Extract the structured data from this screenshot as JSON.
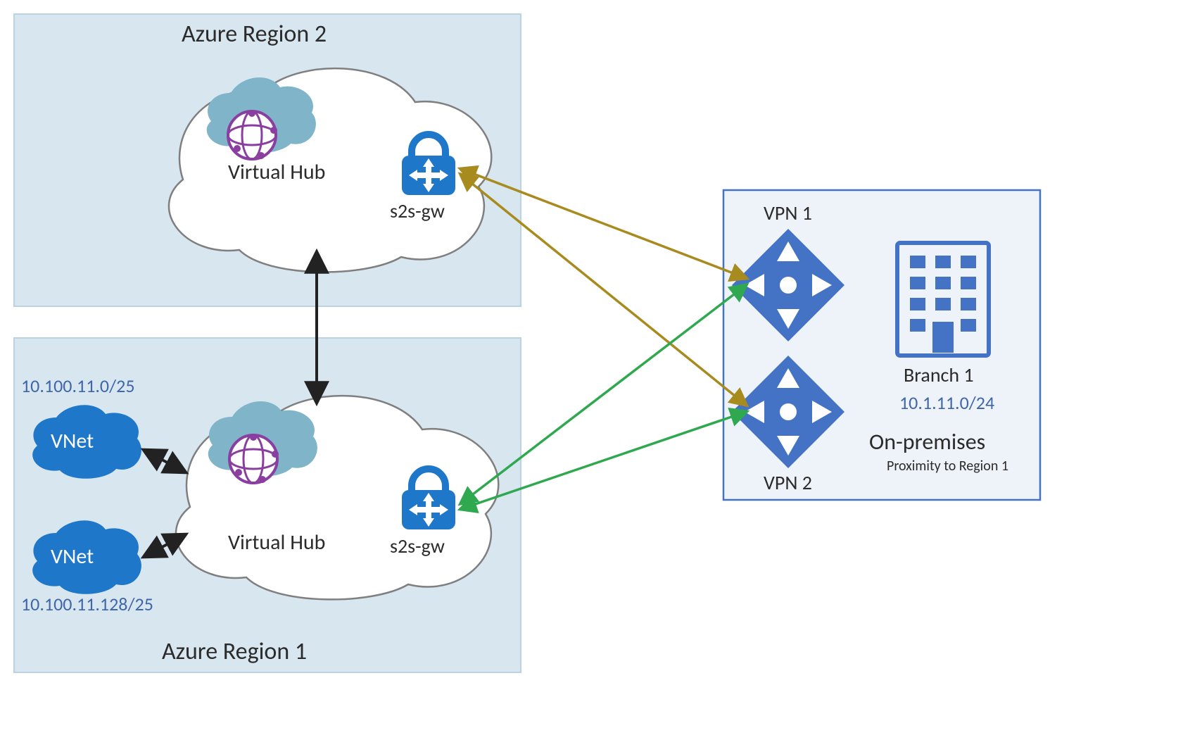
{
  "regions": {
    "r2": {
      "title": "Azure Region 2",
      "hub": "Virtual Hub",
      "gw": "s2s-gw"
    },
    "r1": {
      "title": "Azure Region 1",
      "hub": "Virtual Hub",
      "gw": "s2s-gw",
      "vnet_top_label": "VNet",
      "vnet_bottom_label": "VNet",
      "cidr_top": "10.100.11.0/25",
      "cidr_bottom": "10.100.11.128/25"
    }
  },
  "onprem": {
    "title": "On-premises",
    "subtitle": "Proximity to Region 1",
    "vpn1": "VPN 1",
    "vpn2": "VPN 2",
    "branch": "Branch 1",
    "branch_cidr": "10.1.11.0/24"
  },
  "colors": {
    "region_fill": "#d8e6f0",
    "region_stroke": "#bcd2e0",
    "onprem_fill": "#eef3fa",
    "onprem_stroke": "#4472c4",
    "azure_blue": "#1f77c9",
    "cloud_accent": "#7fb4c9",
    "purple": "#8a3fa0",
    "olive": "#a88b1f",
    "green": "#2fa84f",
    "black": "#222222"
  }
}
